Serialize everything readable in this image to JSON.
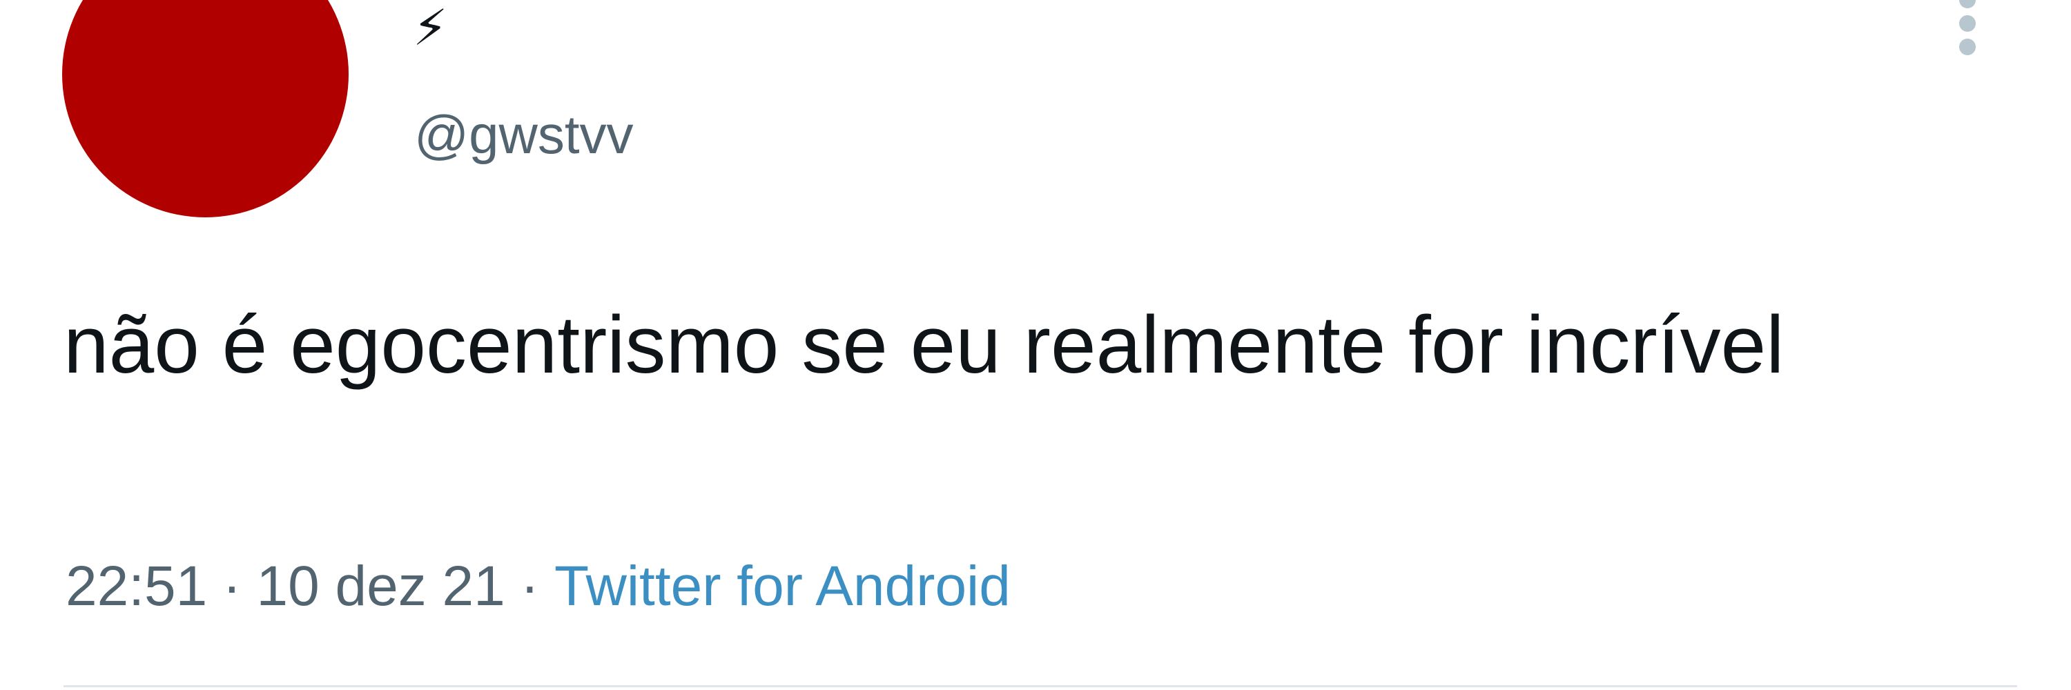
{
  "tweet": {
    "display_name": "⚡",
    "handle": "@gwstvv",
    "text": "não é egocentrismo se eu realmente for incrível",
    "time": "22:51",
    "date": "10 dez 21",
    "separator": "·",
    "source": "Twitter for Android"
  },
  "colors": {
    "avatar": "#b00000",
    "text": "#0f1419",
    "secondary": "#536471",
    "link": "#3b8fc2"
  },
  "icons": {
    "more": "more-options-icon"
  }
}
